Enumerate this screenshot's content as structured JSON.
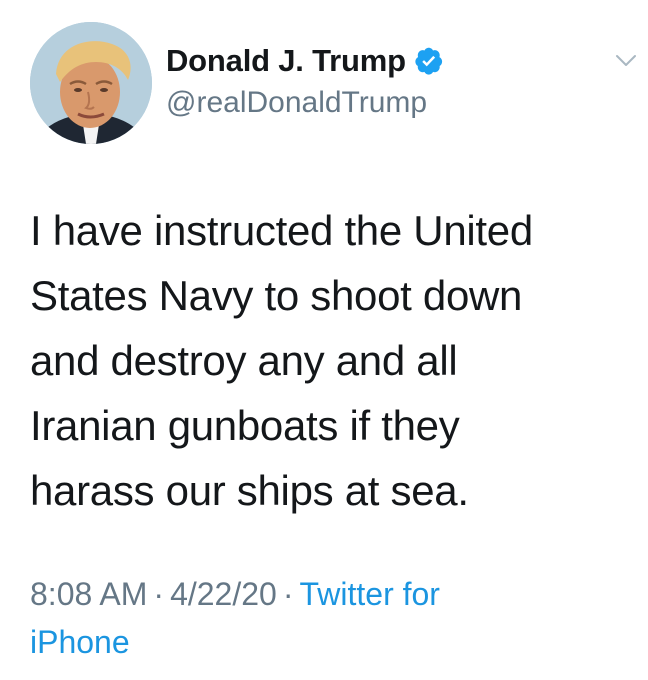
{
  "author": {
    "display_name": "Donald J. Trump",
    "handle": "@realDonaldTrump",
    "verified": true,
    "avatar_icon": "profile-photo"
  },
  "tweet": {
    "text_lines": [
      "I have instructed the United",
      "States Navy to shoot down",
      "and destroy any and all",
      "Iranian gunboats if they",
      "harass our ships at sea."
    ]
  },
  "meta": {
    "time": "8:08 AM",
    "date": "4/22/20",
    "separator": "·",
    "source_line1": "Twitter for",
    "source_line2": "iPhone"
  },
  "icons": {
    "verified": "verified-badge-icon",
    "menu": "chevron-down-icon"
  },
  "colors": {
    "text": "#14171a",
    "secondary": "#657786",
    "accent": "#1b95e0",
    "verified_badge": "#1da1f2"
  }
}
